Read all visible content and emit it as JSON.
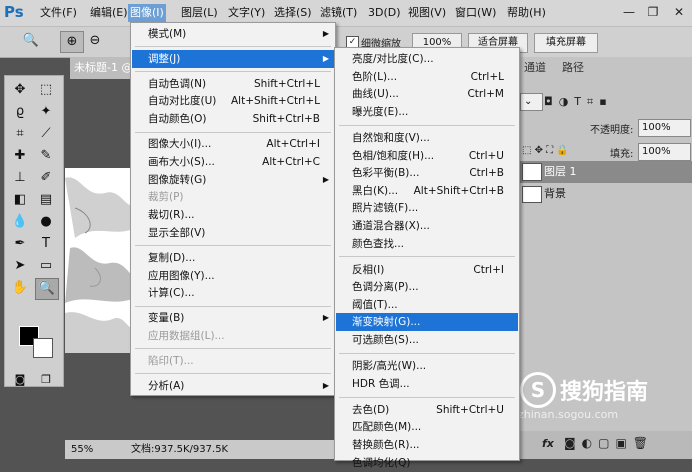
{
  "app": {
    "logo": "Ps"
  },
  "menubar": {
    "items": [
      "文件(F)",
      "编辑(E)",
      "图像(I)",
      "图层(L)",
      "文字(Y)",
      "选择(S)",
      "滤镜(T)",
      "3D(D)",
      "视图(V)",
      "窗口(W)",
      "帮助(H)"
    ],
    "active": "图像(I)",
    "win_minimize": "—",
    "win_restore": "❐",
    "win_close": "✕"
  },
  "optbar": {
    "zoom_all": "细微缩放",
    "zoom_pct": "100%",
    "fit_screen": "适合屏幕",
    "fill_screen": "填充屏幕"
  },
  "document": {
    "tab": "未标题-1 @",
    "status_zoom": "55%",
    "status_doc": "文档:937.5K/937.5K"
  },
  "panels": {
    "tabs": [
      "通道",
      "路径"
    ],
    "opacity_label": "不透明度:",
    "opacity_value": "100%",
    "fill_label": "填充:",
    "fill_value": "100%",
    "layers": [
      "图层 1",
      "背景"
    ],
    "footer_fx": "fx"
  },
  "image_menu": [
    {
      "label": "模式(M)",
      "shortcut": "",
      "submenu": true,
      "disabled": false
    },
    {
      "sep": true
    },
    {
      "label": "调整(J)",
      "shortcut": "",
      "submenu": true,
      "highlight": true
    },
    {
      "sep": true
    },
    {
      "label": "自动色调(N)",
      "shortcut": "Shift+Ctrl+L"
    },
    {
      "label": "自动对比度(U)",
      "shortcut": "Alt+Shift+Ctrl+L"
    },
    {
      "label": "自动颜色(O)",
      "shortcut": "Shift+Ctrl+B"
    },
    {
      "sep": true
    },
    {
      "label": "图像大小(I)...",
      "shortcut": "Alt+Ctrl+I"
    },
    {
      "label": "画布大小(S)...",
      "shortcut": "Alt+Ctrl+C"
    },
    {
      "label": "图像旋转(G)",
      "shortcut": "",
      "submenu": true
    },
    {
      "label": "裁剪(P)",
      "shortcut": "",
      "disabled": true
    },
    {
      "label": "裁切(R)...",
      "shortcut": ""
    },
    {
      "label": "显示全部(V)",
      "shortcut": ""
    },
    {
      "sep": true
    },
    {
      "label": "复制(D)...",
      "shortcut": ""
    },
    {
      "label": "应用图像(Y)...",
      "shortcut": ""
    },
    {
      "label": "计算(C)...",
      "shortcut": ""
    },
    {
      "sep": true
    },
    {
      "label": "变量(B)",
      "shortcut": "",
      "submenu": true
    },
    {
      "label": "应用数据组(L)...",
      "shortcut": "",
      "disabled": true
    },
    {
      "sep": true
    },
    {
      "label": "陷印(T)...",
      "shortcut": "",
      "disabled": true
    },
    {
      "sep": true
    },
    {
      "label": "分析(A)",
      "shortcut": "",
      "submenu": true
    }
  ],
  "adjust_menu": [
    {
      "label": "亮度/对比度(C)...",
      "shortcut": ""
    },
    {
      "label": "色阶(L)...",
      "shortcut": "Ctrl+L"
    },
    {
      "label": "曲线(U)...",
      "shortcut": "Ctrl+M"
    },
    {
      "label": "曝光度(E)...",
      "shortcut": ""
    },
    {
      "sep": true
    },
    {
      "label": "自然饱和度(V)...",
      "shortcut": ""
    },
    {
      "label": "色相/饱和度(H)...",
      "shortcut": "Ctrl+U"
    },
    {
      "label": "色彩平衡(B)...",
      "shortcut": "Ctrl+B"
    },
    {
      "label": "黑白(K)...",
      "shortcut": "Alt+Shift+Ctrl+B"
    },
    {
      "label": "照片滤镜(F)...",
      "shortcut": ""
    },
    {
      "label": "通道混合器(X)...",
      "shortcut": ""
    },
    {
      "label": "颜色查找...",
      "shortcut": ""
    },
    {
      "sep": true
    },
    {
      "label": "反相(I)",
      "shortcut": "Ctrl+I"
    },
    {
      "label": "色调分离(P)...",
      "shortcut": ""
    },
    {
      "label": "阈值(T)...",
      "shortcut": ""
    },
    {
      "label": "渐变映射(G)...",
      "shortcut": "",
      "highlight": true
    },
    {
      "label": "可选颜色(S)...",
      "shortcut": ""
    },
    {
      "sep": true
    },
    {
      "label": "阴影/高光(W)...",
      "shortcut": ""
    },
    {
      "label": "HDR 色调...",
      "shortcut": ""
    },
    {
      "sep": true
    },
    {
      "label": "去色(D)",
      "shortcut": "Shift+Ctrl+U"
    },
    {
      "label": "匹配颜色(M)...",
      "shortcut": ""
    },
    {
      "label": "替换颜色(R)...",
      "shortcut": ""
    },
    {
      "label": "色调均化(Q)",
      "shortcut": ""
    }
  ],
  "watermark": {
    "text": "搜狗指南",
    "url": "zhinan.sogou.com",
    "logo_letter": "S"
  }
}
